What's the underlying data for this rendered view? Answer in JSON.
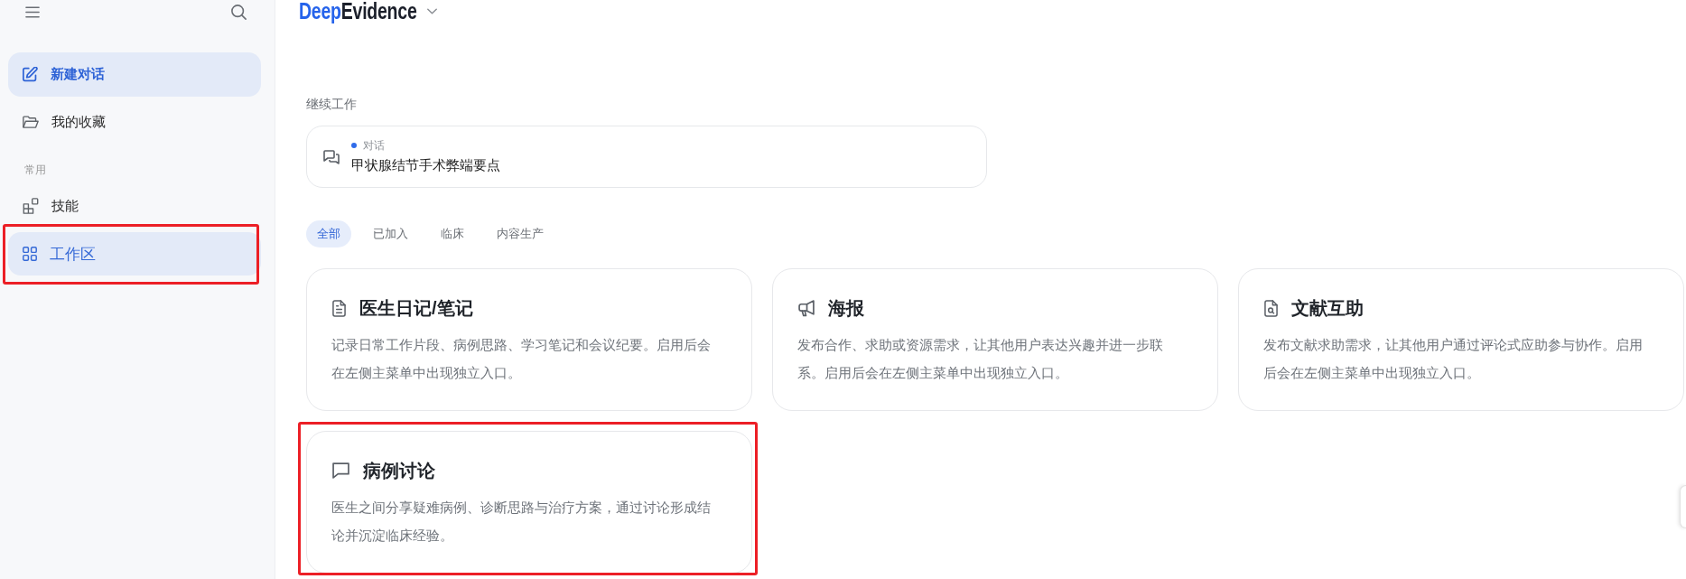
{
  "sidebar": {
    "new_chat_button": "新建对话",
    "favorites": "我的收藏",
    "sections": [
      {
        "title": "常用",
        "items": [
          {
            "kind": "skills",
            "label": "技能",
            "selected": false,
            "highlighted": false
          },
          {
            "kind": "workspace",
            "label": "工作区",
            "selected": true,
            "highlighted": true
          }
        ]
      }
    ]
  },
  "header": {
    "brand_accent": "Deep",
    "brand_rest": "Evidence"
  },
  "continue_work": {
    "title": "继续工作",
    "items": [
      {
        "kind": "chat",
        "type_label": "对话",
        "color": "#2f6bea",
        "title": "甲状腺结节手术弊端要点"
      }
    ]
  },
  "tabs": [
    {
      "label": "全部",
      "selected": true
    },
    {
      "label": "已加入",
      "selected": false
    },
    {
      "label": "临床",
      "selected": false
    },
    {
      "label": "内容生产",
      "selected": false
    }
  ],
  "cards": [
    {
      "kind": "notes",
      "title": "医生日记/笔记",
      "description": "记录日常工作片段、病例思路、学习笔记和会议纪要。启用后会在左侧主菜单中出现独立入口。",
      "highlighted": false
    },
    {
      "kind": "poster",
      "title": "海报",
      "description": "发布合作、求助或资源需求，让其他用户表达兴趣并进一步联系。启用后会在左侧主菜单中出现独立入口。",
      "highlighted": false
    },
    {
      "kind": "literature",
      "title": "文献互助",
      "description": "发布文献求助需求，让其他用户通过评论式应助参与协作。启用后会在左侧主菜单中出现独立入口。",
      "highlighted": false
    },
    {
      "kind": "discussion",
      "title": "病例讨论",
      "description": "医生之间分享疑难病例、诊断思路与治疗方案，通过讨论形成结论并沉淀临床经验。",
      "highlighted": true
    }
  ]
}
